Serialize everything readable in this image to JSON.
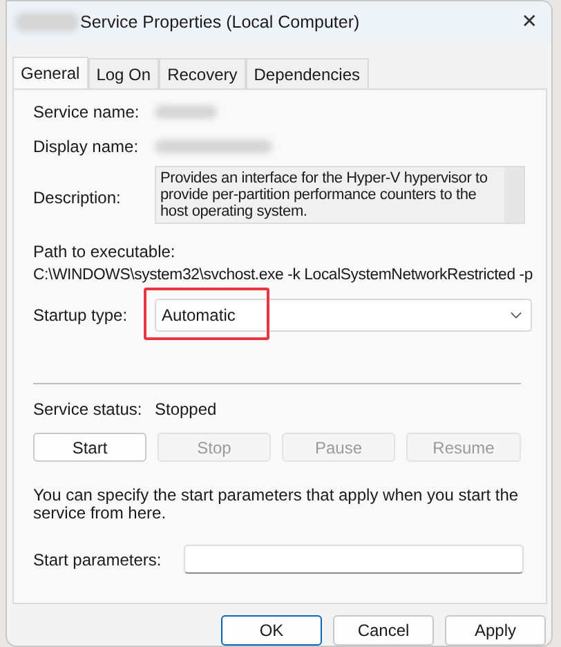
{
  "window": {
    "title": "Service Properties (Local Computer)",
    "title_prefix_blurred": true,
    "close": "✕"
  },
  "tabs": [
    {
      "label": "General",
      "selected": true
    },
    {
      "label": "Log On",
      "selected": false
    },
    {
      "label": "Recovery",
      "selected": false
    },
    {
      "label": "Dependencies",
      "selected": false
    }
  ],
  "fields": [
    {
      "label": "Service name:",
      "kind": "blurred"
    },
    {
      "label": "Display name:",
      "kind": "blurred"
    },
    {
      "label": "Description:",
      "kind": "textbox",
      "value": "Provides an interface for the Hyper-V hypervisor to provide per-partition performance counters to the host operating system."
    }
  ],
  "path": {
    "label": "Path to executable:",
    "value": "C:\\WINDOWS\\system32\\svchost.exe -k LocalSystemNetworkRestricted -p"
  },
  "startup_type": {
    "label": "Startup type:",
    "value": "Automatic",
    "highlighted": true
  },
  "service_status": {
    "label": "Service status:",
    "value": "Stopped"
  },
  "service_buttons": [
    {
      "label": "Start",
      "disabled": false
    },
    {
      "label": "Stop",
      "disabled": true
    },
    {
      "label": "Pause",
      "disabled": true
    },
    {
      "label": "Resume",
      "disabled": true
    }
  ],
  "hint": "You can specify the start parameters that apply when you start the service from here.",
  "start_parameters": {
    "label": "Start parameters:"
  },
  "dialog_buttons": [
    {
      "label": "OK",
      "default": true
    },
    {
      "label": "Cancel",
      "default": false
    },
    {
      "label": "Apply",
      "default": false
    }
  ]
}
